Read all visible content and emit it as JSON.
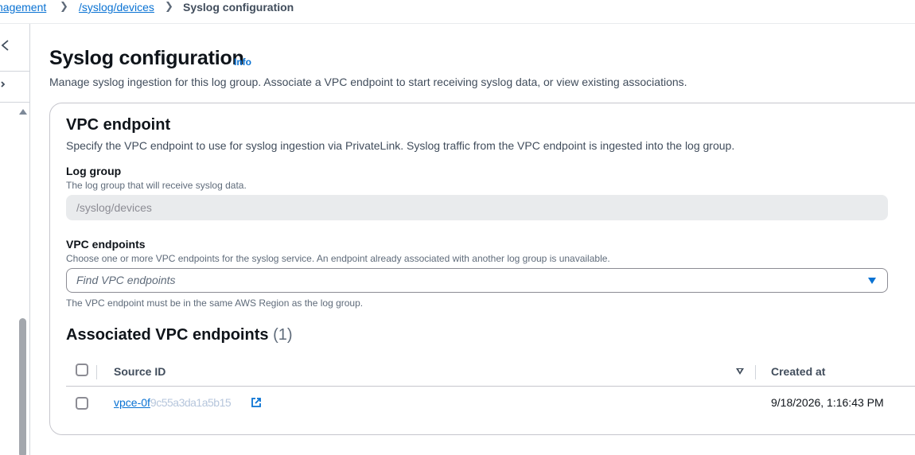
{
  "breadcrumb": {
    "items": [
      {
        "label": "nagement"
      },
      {
        "label": "/syslog/devices"
      }
    ],
    "current": "Syslog configuration"
  },
  "page": {
    "title": "Syslog configuration",
    "info_label": "Info",
    "description": "Manage syslog ingestion for this log group. Associate a VPC endpoint to start receiving syslog data, or view existing associations."
  },
  "vpc_section": {
    "title": "VPC endpoint",
    "description": "Specify the VPC endpoint to use for syslog ingestion via PrivateLink. Syslog traffic from the VPC endpoint is ingested into the log group.",
    "log_group": {
      "label": "Log group",
      "description": "The log group that will receive syslog data.",
      "value": "/syslog/devices"
    },
    "vpc_endpoints": {
      "label": "VPC endpoints",
      "description": "Choose one or more VPC endpoints for the syslog service. An endpoint already associated with another log group is unavailable.",
      "placeholder": "Find VPC endpoints",
      "constraint": "The VPC endpoint must be in the same AWS Region as the log group."
    }
  },
  "associated": {
    "title": "Associated VPC endpoints",
    "count": "(1)",
    "columns": {
      "source_id": "Source ID",
      "created_at": "Created at"
    },
    "rows": [
      {
        "source_id_visible": "vpce-0f",
        "source_id_redacted": "9c55a3da1a5b15",
        "created_at": "9/18/2026, 1:16:43 PM"
      }
    ]
  },
  "colors": {
    "link": "#0972d3",
    "text": "#0f141a",
    "muted": "#5f6b7a",
    "border": "#c6c6cd"
  },
  "icons": [
    "chevron-left-icon",
    "caret-right-icon",
    "dropdown-caret-icon",
    "sort-icon",
    "external-link-icon"
  ]
}
